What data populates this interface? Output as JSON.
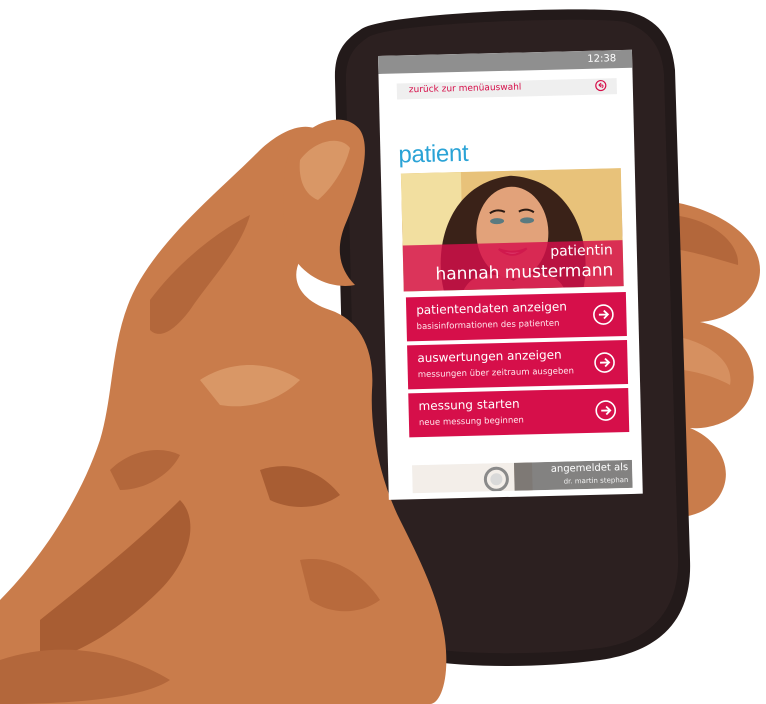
{
  "statusbar": {
    "time": "12:38"
  },
  "backbar": {
    "label": "zurück zur menüauswahl",
    "icon": "back-arrow-circle-icon"
  },
  "page": {
    "title": "patient"
  },
  "patient": {
    "role": "patientin",
    "name": "hannah mustermann"
  },
  "tiles": [
    {
      "title": "patientendaten anzeigen",
      "subtitle": "basisinformationen des patienten",
      "icon": "arrow-right-circle-icon"
    },
    {
      "title": "auswertungen anzeigen",
      "subtitle": "messungen über zeitraum ausgeben",
      "icon": "arrow-right-circle-icon"
    },
    {
      "title": "messung starten",
      "subtitle": "neue messung beginnen",
      "icon": "arrow-right-circle-icon"
    }
  ],
  "login": {
    "label": "angemeldet als",
    "user": "dr. martin stephan"
  },
  "colors": {
    "accent": "#d60f4a",
    "title_blue": "#2aa3d6",
    "statusbar": "#8f8f8f",
    "phone_body": "#231a1a",
    "skin": "#c97c4b"
  }
}
